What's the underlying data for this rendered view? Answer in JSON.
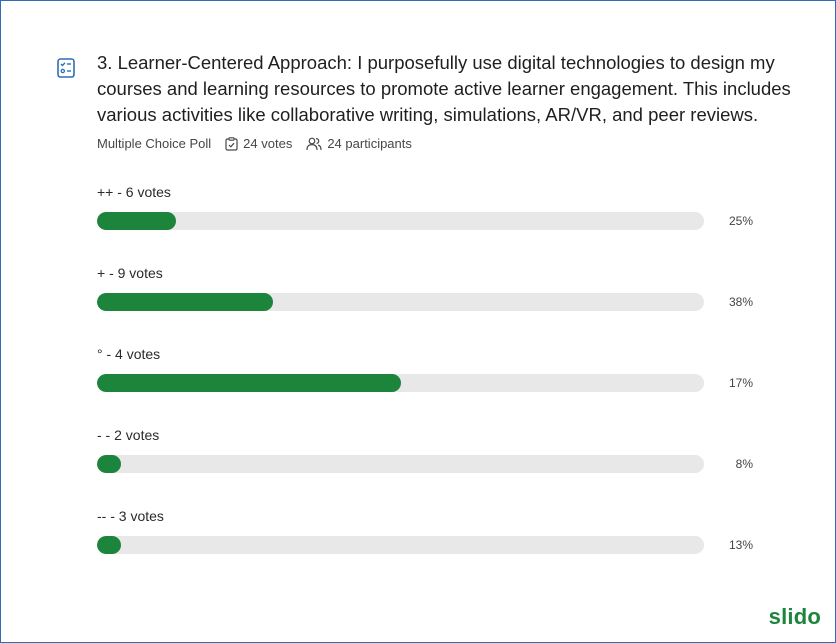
{
  "poll": {
    "question": "3. Learner-Centered Approach: I purposefully use digital technologies to design my courses and learning resources to promote active learner engagement. This includes various activities like collaborative writing, simulations, AR/VR, and peer reviews.",
    "type_label": "Multiple Choice Poll",
    "votes_label": "24 votes",
    "participants_label": "24 participants"
  },
  "options": [
    {
      "label": "++ - 6 votes",
      "percent_label": "25%",
      "bar_fill_percent": 13
    },
    {
      "label": "+ - 9 votes",
      "percent_label": "38%",
      "bar_fill_percent": 29
    },
    {
      "label": "° - 4 votes",
      "percent_label": "17%",
      "bar_fill_percent": 50
    },
    {
      "label": "- - 2 votes",
      "percent_label": "8%",
      "bar_fill_percent": 4
    },
    {
      "label": "-- - 3 votes",
      "percent_label": "13%",
      "bar_fill_percent": 4
    }
  ],
  "colors": {
    "accent": "#1c843b",
    "track": "#e8e8e8",
    "border": "#2f6db5"
  },
  "icons": [
    "poll-list-icon",
    "clipboard-check-icon",
    "participants-icon"
  ],
  "brand": {
    "name": "slido"
  }
}
